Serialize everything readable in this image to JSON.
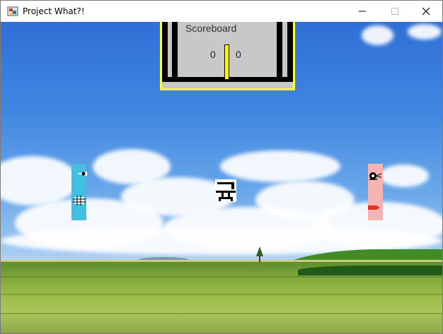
{
  "window": {
    "title": "Project What?!",
    "controls": [
      "minimize",
      "maximize",
      "close"
    ]
  },
  "icons": {
    "app": "app-icon",
    "minimize": "minimize-icon",
    "maximize": "maximize-icon",
    "close": "close-icon",
    "ball": "ball-sprite",
    "left_paddle_eye": "eye-icon",
    "left_paddle_crosshair": "crosshair-icon",
    "right_paddle_eye": "eye-icon",
    "right_paddle_flag": "flag-icon"
  },
  "scoreboard": {
    "label": "Scoreboard",
    "left_score": "0",
    "right_score": "0"
  },
  "colors": {
    "scoreboard_border": "#ffff33",
    "scoreboard_bg": "#c8c8c8",
    "left_paddle": "#43bfe0",
    "right_paddle": "#f5b4b4",
    "center_line": "#ffff00"
  }
}
